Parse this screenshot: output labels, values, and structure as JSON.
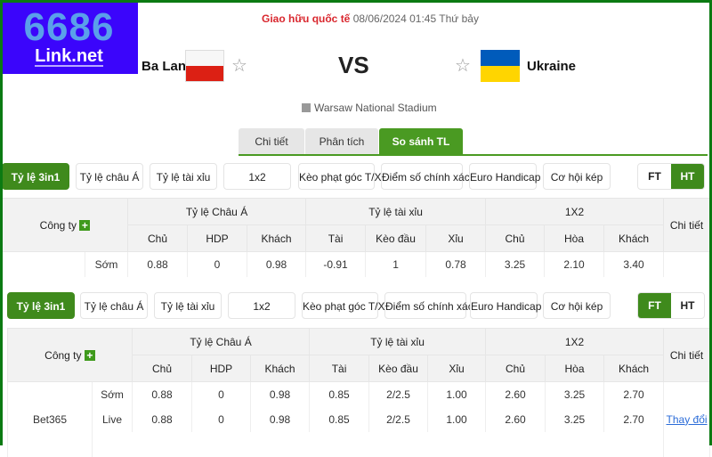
{
  "logo": {
    "line1": "6686",
    "line2": "Link.net"
  },
  "match": {
    "league": "Giao hữu quốc tế",
    "datetime": "08/06/2024 01:45 Thứ bảy",
    "home": "Ba Lan",
    "away": "Ukraine",
    "vs": "VS",
    "venue": "Warsaw National Stadium"
  },
  "tabs": [
    "Chi tiết",
    "Phân tích",
    "So sánh TL"
  ],
  "odds_tabs": [
    "Tỷ lệ 3in1",
    "Tỷ lệ châu Á",
    "Tỷ lệ tài xỉu",
    "1x2",
    "Kèo phạt góc T/X",
    "Điểm số chính xác",
    "Euro Handicap",
    "Cơ hội kép"
  ],
  "period": {
    "ft": "FT",
    "ht": "HT"
  },
  "headers": {
    "company": "Công ty",
    "plus": "+",
    "asian": "Tỷ lệ Châu Á",
    "ou": "Tỷ lệ tài xỉu",
    "x12": "1X2",
    "detail": "Chi tiết",
    "cols": [
      "Chủ",
      "HDP",
      "Khách",
      "Tài",
      "Kèo đầu",
      "Xỉu",
      "Chủ",
      "Hòa",
      "Khách"
    ]
  },
  "table_ht": {
    "rows": [
      {
        "company": "",
        "type": "Sớm",
        "values": [
          "0.88",
          "0",
          "0.98",
          "-0.91",
          "1",
          "0.78",
          "3.25",
          "2.10",
          "3.40"
        ]
      }
    ]
  },
  "table_ft": {
    "company": "Bet365",
    "detail_link": "Thay đổi",
    "rows": [
      {
        "type": "Sớm",
        "values": [
          "0.88",
          "0",
          "0.98",
          "0.85",
          "2/2.5",
          "1.00",
          "2.60",
          "3.25",
          "2.70"
        ]
      },
      {
        "type": "Live",
        "values": [
          "0.88",
          "0",
          "0.98",
          "0.85",
          "2/2.5",
          "1.00",
          "2.60",
          "3.25",
          "2.70"
        ]
      }
    ]
  },
  "colors": {
    "accent": "#3f8a1c",
    "league": "#d9272e",
    "logo_bg": "#3b05fb"
  }
}
